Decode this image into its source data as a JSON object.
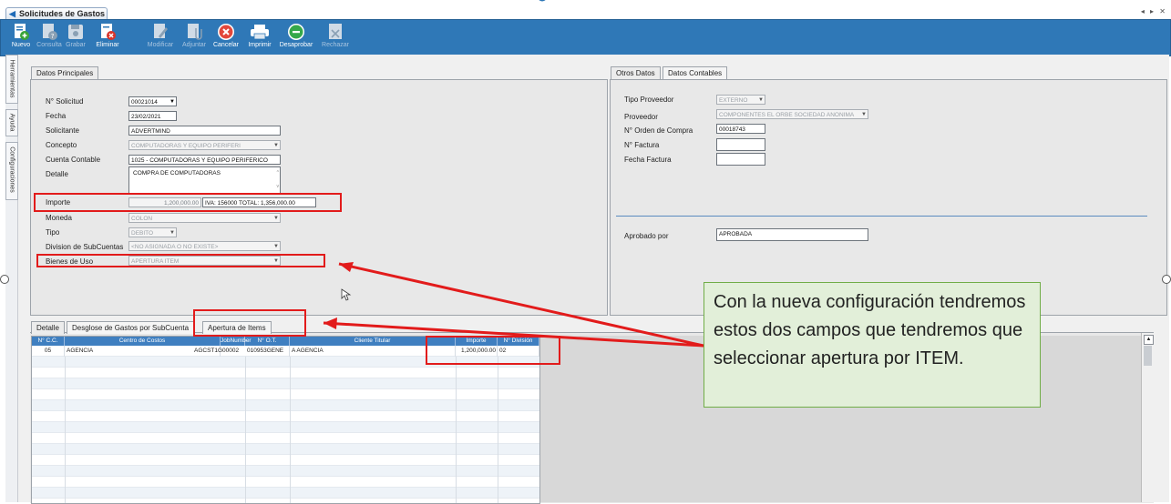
{
  "window": {
    "tab_title": "Solicitudes de Gastos",
    "controls": "◂ ▸ ✕"
  },
  "toolbar": {
    "buttons": [
      {
        "label": "Nuevo",
        "enabled": true
      },
      {
        "label": "Consulta",
        "enabled": false
      },
      {
        "label": "Grabar",
        "enabled": false
      },
      {
        "label": "Eliminar",
        "enabled": true
      },
      {
        "label": "Modificar",
        "enabled": false
      },
      {
        "label": "Adjuntar",
        "enabled": false
      },
      {
        "label": "Cancelar",
        "enabled": true
      },
      {
        "label": "Imprimir",
        "enabled": true
      },
      {
        "label": "Desaprobar",
        "enabled": true
      },
      {
        "label": "Rechazar",
        "enabled": false
      }
    ]
  },
  "side_rail": [
    "Herramientas",
    "Ayuda",
    "Configuraciones"
  ],
  "principal": {
    "tab": "Datos Principales",
    "labels": {
      "solicitud": "N° Solicitud",
      "fecha": "Fecha",
      "solicitante": "Solicitante",
      "concepto": "Concepto",
      "cuenta": "Cuenta Contable",
      "detalle": "Detalle",
      "importe": "Importe",
      "moneda": "Moneda",
      "tipo": "Tipo",
      "division": "Division de SubCuentas",
      "bienes": "Bienes de Uso"
    },
    "values": {
      "solicitud": "00021014",
      "fecha": "23/02/2021",
      "solicitante": "ADVERTMIND",
      "concepto": "COMPUTADORAS Y EQUIPO PERIFERI",
      "cuenta": "1025 - COMPUTADORAS Y EQUIPO PERIFERICO",
      "detalle": "COMPRA DE COMPUTADORAS",
      "importe": "1,200,000.00",
      "iva_total": "IVA: 156000 TOTAL:  1,356,000.00",
      "moneda": "COLON",
      "tipo": "DEBITO",
      "division": "<NO ASIGNADA O NO EXISTE>",
      "bienes": "APERTURA ITEM"
    }
  },
  "otros": {
    "tabs": [
      "Otros Datos",
      "Datos Contables"
    ],
    "labels": {
      "tipo_proveedor": "Tipo Proveedor",
      "proveedor": "Proveedor",
      "orden": "N° Orden de Compra",
      "factura": "N° Factura",
      "fecha_factura": "Fecha Factura",
      "aprobado": "Aprobado por"
    },
    "values": {
      "tipo_proveedor": "EXTERNO",
      "proveedor": "COMPONENTES EL ORBE SOCIEDAD ANONIMA",
      "orden": "00018743",
      "factura": "",
      "fecha_factura": "",
      "aprobado": "APROBADA"
    }
  },
  "lower_tabs": [
    "Detalle",
    "Desglose de Gastos por SubCuenta",
    "Apertura de Items"
  ],
  "grid": {
    "columns": [
      "N° C.C.",
      "Centro de Costos",
      "JobNumber",
      "N° O.T.",
      "Cliente Titular",
      "Importe",
      "N° División"
    ],
    "rows": [
      [
        "05",
        "AGENCIA",
        "AGCST1G00002",
        "010953GENE",
        "A AGENCIA",
        "1,200,000.00",
        "02"
      ]
    ]
  },
  "callout": {
    "text": "Con la nueva configuración tendremos estos dos campos que tendremos que seleccionar apertura por ITEM."
  },
  "colors": {
    "toolbar": "#2f78b7",
    "grid_header": "#3f7fc0",
    "annotation_red": "#e21b1b",
    "callout_fill": "#e2efd9",
    "callout_border": "#70ad47"
  }
}
